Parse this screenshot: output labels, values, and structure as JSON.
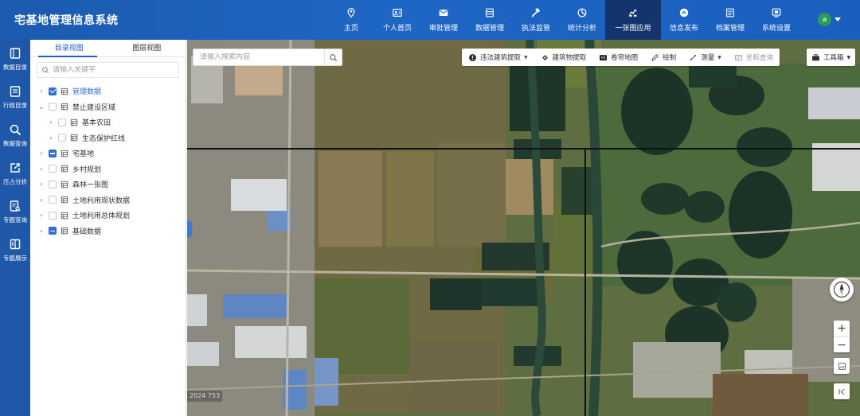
{
  "app": {
    "title": "宅基地管理信息系统"
  },
  "nav": [
    {
      "label": "主页",
      "icon": "home-icon"
    },
    {
      "label": "个人首页",
      "icon": "user-card-icon"
    },
    {
      "label": "审批管理",
      "icon": "mail-icon"
    },
    {
      "label": "数据管理",
      "icon": "database-icon"
    },
    {
      "label": "执法监管",
      "icon": "hammer-icon"
    },
    {
      "label": "统计分析",
      "icon": "chart-icon"
    },
    {
      "label": "一张图应用",
      "icon": "map-icon",
      "active": true
    },
    {
      "label": "信息发布",
      "icon": "broadcast-icon"
    },
    {
      "label": "档案管理",
      "icon": "archive-icon"
    },
    {
      "label": "系统设置",
      "icon": "settings-icon"
    }
  ],
  "user": {
    "avatar_letter": "a"
  },
  "rail": [
    {
      "label": "数据目录",
      "icon": "book-icon"
    },
    {
      "label": "行政目录",
      "icon": "list-icon"
    },
    {
      "label": "数据查询",
      "icon": "search-icon"
    },
    {
      "label": "压占分析",
      "icon": "export-icon"
    },
    {
      "label": "专题查询",
      "icon": "doc-search-icon"
    },
    {
      "label": "专题展示",
      "icon": "book-open-icon"
    }
  ],
  "panel": {
    "tabs": [
      "目录视图",
      "图层视图"
    ],
    "active_tab": 0,
    "search_placeholder": "请输入关键字",
    "tree": [
      {
        "label": "管理数据",
        "level": 0,
        "arrow": "›",
        "check": "checked",
        "highlight": true
      },
      {
        "label": "禁止建设区域",
        "level": 0,
        "arrow": "⌄",
        "check": "none"
      },
      {
        "label": "基本农田",
        "level": 1,
        "arrow": "›",
        "check": "none"
      },
      {
        "label": "生态保护红线",
        "level": 1,
        "arrow": "›",
        "check": "none"
      },
      {
        "label": "宅基地",
        "level": 0,
        "arrow": "›",
        "check": "partial"
      },
      {
        "label": "乡村规划",
        "level": 0,
        "arrow": "›",
        "check": "none"
      },
      {
        "label": "森林一张图",
        "level": 0,
        "arrow": "›",
        "check": "none"
      },
      {
        "label": "土地利用现状数据",
        "level": 0,
        "arrow": "›",
        "check": "none"
      },
      {
        "label": "土地利用总体规划",
        "level": 0,
        "arrow": "›",
        "check": "none"
      },
      {
        "label": "基础数据",
        "level": 0,
        "arrow": "›",
        "check": "partial"
      }
    ]
  },
  "map": {
    "search_placeholder": "请输入搜索内容",
    "tools": [
      {
        "label": "违法建筑提取",
        "dropdown": true,
        "icon": "warning-icon"
      },
      {
        "label": "建筑物提取",
        "icon": "building-extract-icon"
      },
      {
        "label": "卷帘地图",
        "icon": "swipe-icon"
      },
      {
        "label": "绘制",
        "icon": "pen-icon"
      },
      {
        "label": "测量",
        "dropdown": true,
        "icon": "ruler-icon"
      },
      {
        "label": "坐标查询",
        "icon": "coordinate-icon",
        "disabled": true
      }
    ],
    "toolbox_label": "工具箱",
    "scale_text": "2024 753"
  }
}
